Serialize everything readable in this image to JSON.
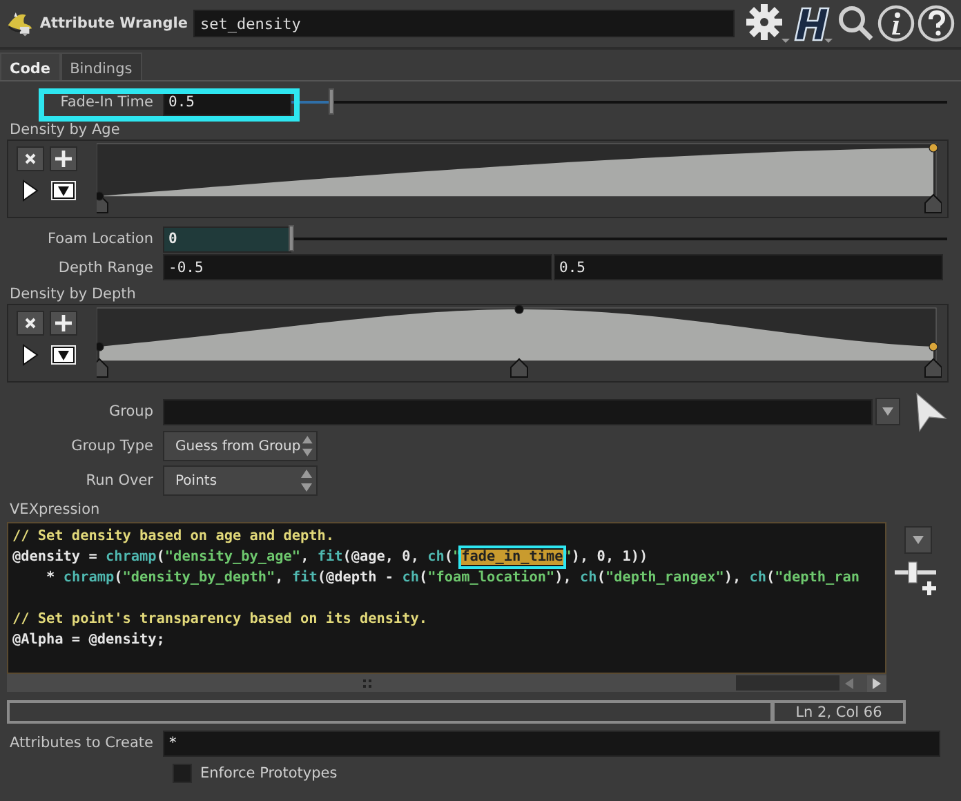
{
  "header": {
    "node_type": "Attribute Wrangle",
    "node_name": "set_density"
  },
  "tabs": [
    {
      "label": "Code",
      "selected": true
    },
    {
      "label": "Bindings",
      "selected": false
    }
  ],
  "parameters": [
    {
      "kind": "slider",
      "label": "Fade-In Time",
      "value": "0.5",
      "level": 0.06,
      "tinted": false,
      "highlighted": true
    },
    {
      "kind": "ramp",
      "label": "Density by Age",
      "peaked": false
    },
    {
      "kind": "slider",
      "label": "Foam Location",
      "value": "0",
      "level": 0.0,
      "tinted": true,
      "highlighted": false
    },
    {
      "kind": "vector2",
      "label": "Depth Range",
      "values": [
        "-0.5",
        "0.5"
      ]
    },
    {
      "kind": "ramp",
      "label": "Density by Depth",
      "peaked": true
    },
    {
      "kind": "group",
      "label": "Group"
    },
    {
      "kind": "menu",
      "label": "Group Type",
      "value": "Guess from Group"
    },
    {
      "kind": "menu",
      "label": "Run Over",
      "value": "Points"
    },
    {
      "kind": "code",
      "label": "VEXpression",
      "cursor_position": "Ln 2, Col 66",
      "lines": [
        {
          "blank_before": false,
          "tokens": [
            {
              "kind": "comment",
              "text": "// Set density based on age and depth."
            }
          ]
        },
        {
          "blank_before": false,
          "tokens": [
            {
              "kind": "plain",
              "text": "@density = "
            },
            {
              "kind": "function",
              "text": "chramp"
            },
            {
              "kind": "plain",
              "text": "("
            },
            {
              "kind": "string",
              "text": "\"density_by_age\""
            },
            {
              "kind": "plain",
              "text": ", "
            },
            {
              "kind": "function",
              "text": "fit"
            },
            {
              "kind": "plain",
              "text": "(@age, 0, "
            },
            {
              "kind": "function",
              "text": "ch"
            },
            {
              "kind": "plain",
              "text": "("
            },
            {
              "kind": "string",
              "text": "\""
            },
            {
              "kind": "selected",
              "text": "fade_in_time",
              "highlighted": true
            },
            {
              "kind": "string",
              "text": "\""
            },
            {
              "kind": "plain",
              "text": "), 0, 1))"
            }
          ]
        },
        {
          "blank_before": false,
          "tokens": [
            {
              "kind": "plain",
              "text": "    * "
            },
            {
              "kind": "function",
              "text": "chramp"
            },
            {
              "kind": "plain",
              "text": "("
            },
            {
              "kind": "string",
              "text": "\"density_by_depth\""
            },
            {
              "kind": "plain",
              "text": ", "
            },
            {
              "kind": "function",
              "text": "fit"
            },
            {
              "kind": "plain",
              "text": "(@depth - "
            },
            {
              "kind": "function",
              "text": "ch"
            },
            {
              "kind": "plain",
              "text": "("
            },
            {
              "kind": "string",
              "text": "\"foam_location\""
            },
            {
              "kind": "plain",
              "text": "), "
            },
            {
              "kind": "function",
              "text": "ch"
            },
            {
              "kind": "plain",
              "text": "("
            },
            {
              "kind": "string",
              "text": "\"depth_rangex\""
            },
            {
              "kind": "plain",
              "text": "), "
            },
            {
              "kind": "function",
              "text": "ch"
            },
            {
              "kind": "plain",
              "text": "("
            },
            {
              "kind": "string",
              "text": "\"depth_ran"
            }
          ]
        },
        {
          "blank_before": true,
          "tokens": [
            {
              "kind": "comment",
              "text": "// Set point's transparency based on its density."
            }
          ]
        },
        {
          "blank_before": false,
          "tokens": [
            {
              "kind": "plain",
              "text": "@Alpha = @density;"
            }
          ]
        }
      ]
    },
    {
      "kind": "string",
      "label": "Attributes to Create",
      "value": "*"
    },
    {
      "kind": "toggle",
      "label": "Enforce Prototypes",
      "checked": false
    }
  ]
}
